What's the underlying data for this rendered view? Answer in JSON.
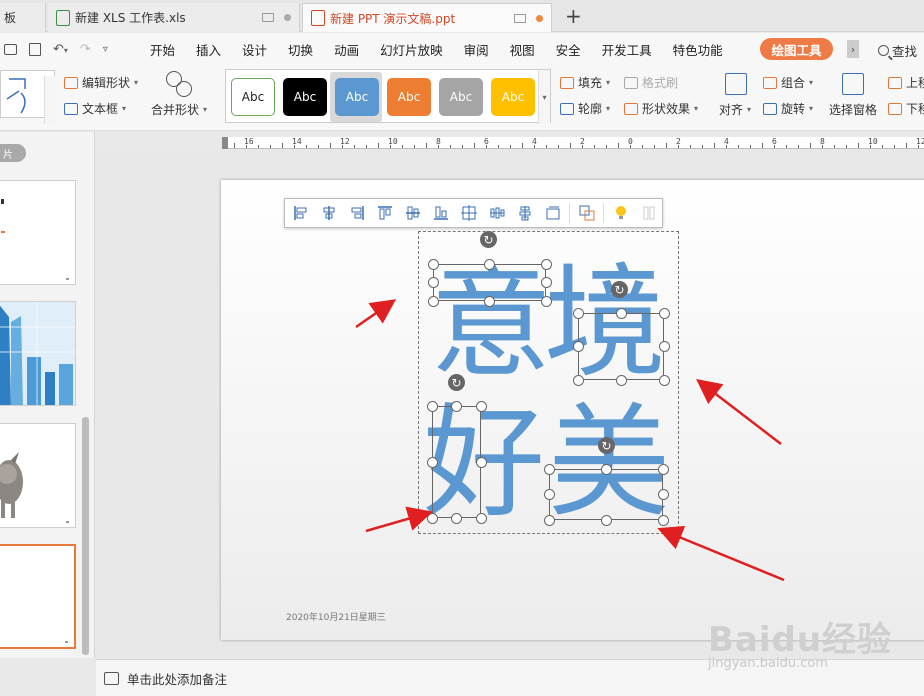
{
  "tabs": [
    {
      "label": "板"
    },
    {
      "label": "新建 XLS 工作表.xls"
    },
    {
      "label": "新建 PPT 演示文稿.ppt"
    }
  ],
  "menu": {
    "items": [
      "开始",
      "插入",
      "设计",
      "切换",
      "动画",
      "幻灯片放映",
      "审阅",
      "视图",
      "安全",
      "开发工具",
      "特色功能"
    ],
    "active": "绘图工具",
    "search": "查找",
    "more": "›"
  },
  "ribbon": {
    "edit_shape": "编辑形状",
    "text_box": "文本框",
    "merge_shape": "合并形状",
    "styles": [
      "Abc",
      "Abc",
      "Abc",
      "Abc",
      "Abc",
      "Abc"
    ],
    "style_colors": [
      "#ffffff",
      "#000000",
      "#5b97d0",
      "#ed7d31",
      "#a5a5a5",
      "#ffc000"
    ],
    "fill": "填充",
    "format_brush": "格式刷",
    "outline": "轮廓",
    "shape_effect": "形状效果",
    "align": "对齐",
    "group": "组合",
    "rotate": "旋转",
    "selection_pane": "选择窗格",
    "bring_forward": "上移",
    "send_backward": "下移"
  },
  "ruler": {
    "numbers": [
      "16",
      "14",
      "12",
      "10",
      "8",
      "6",
      "4",
      "2",
      "0",
      "2",
      "4",
      "6",
      "8",
      "10",
      "12"
    ]
  },
  "panel": {
    "badge": "片"
  },
  "slide": {
    "chars": [
      "意",
      "境",
      "好",
      "美"
    ],
    "date": "2020年10月21日星期三",
    "text_color": "#5b97d0"
  },
  "notes": {
    "placeholder": "单击此处添加备注"
  },
  "watermark": {
    "brand": "Baidu经验",
    "url": "jingyan.baidu.com"
  }
}
